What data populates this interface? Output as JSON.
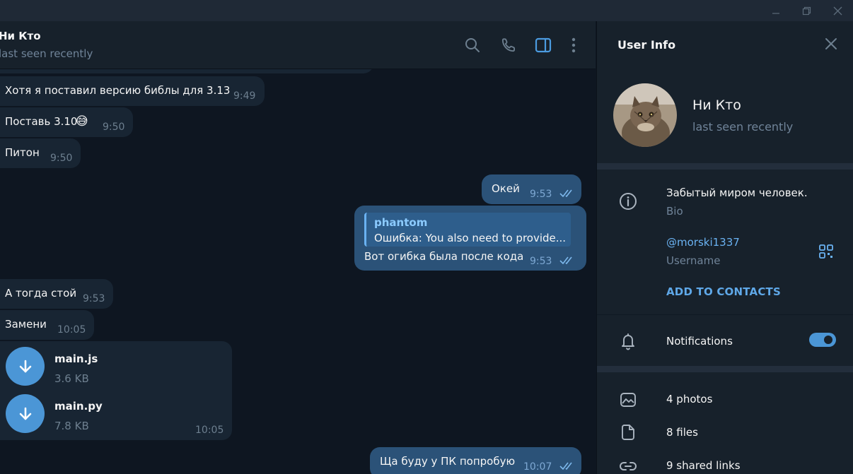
{
  "chat": {
    "title": "Ни Кто",
    "status": "last seen recently"
  },
  "messages": [
    {
      "dir": "in",
      "text": "Хотя я поставил версию библы для 3.13",
      "time": "9:49"
    },
    {
      "dir": "in",
      "text": "Поставь 3.10",
      "emoji": "😅",
      "time": "9:50"
    },
    {
      "dir": "in",
      "text": "Питон",
      "time": "9:50"
    },
    {
      "dir": "out",
      "text": "Окей",
      "time": "9:53"
    },
    {
      "dir": "out",
      "reply_name": "phantom",
      "reply_text": "Ошибка: You also need to provide...",
      "text": "Вот огибка была после кода",
      "time": "9:53"
    },
    {
      "dir": "in",
      "text": "А тогда стой",
      "time": "9:53"
    },
    {
      "dir": "in",
      "text": "Замени",
      "time": "10:05"
    },
    {
      "dir": "in",
      "files": [
        {
          "name": "main.js",
          "size": "3.6 KB"
        },
        {
          "name": "main.py",
          "size": "7.8 KB"
        }
      ],
      "time": "10:05"
    },
    {
      "dir": "out",
      "text": "Ща буду у ПК попробую",
      "time": "10:07"
    }
  ],
  "panel": {
    "title": "User Info",
    "name": "Ни Кто",
    "status": "last seen recently",
    "bio": "Забытый миром человек.",
    "bio_label": "Bio",
    "username": "@morski1337",
    "username_label": "Username",
    "add_contact": "ADD TO CONTACTS",
    "notifications": "Notifications",
    "notifications_on": true,
    "media": [
      {
        "icon": "photo-icon",
        "label": "4 photos"
      },
      {
        "icon": "file-icon",
        "label": "8 files"
      },
      {
        "icon": "link-icon",
        "label": "9 shared links"
      }
    ]
  },
  "colors": {
    "background": "#0e1621",
    "header": "#17212b",
    "incoming_bubble": "#182533",
    "outgoing_bubble": "#2b5278",
    "accent": "#6ab2f2"
  }
}
